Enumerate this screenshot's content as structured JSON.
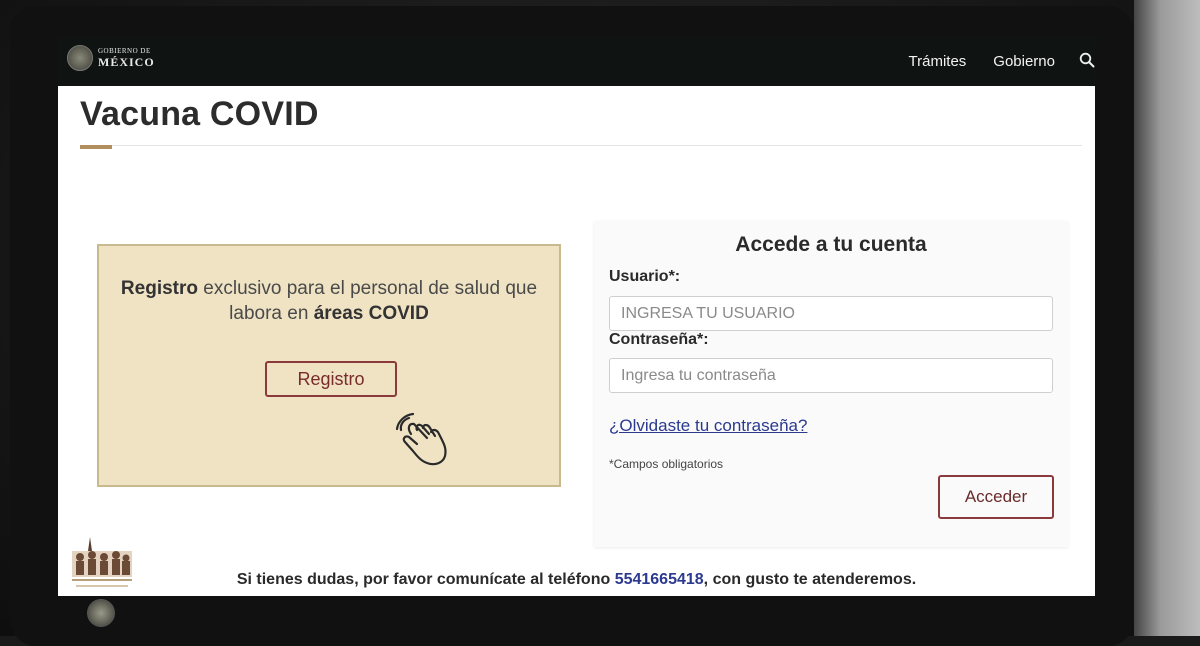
{
  "header": {
    "logo_line1": "GOBIERNO DE",
    "logo_line2": "MÉXICO",
    "nav": [
      {
        "label": "Trámites"
      },
      {
        "label": "Gobierno"
      }
    ]
  },
  "page": {
    "title": "Vacuna COVID"
  },
  "promo": {
    "text_bold1": "Registro",
    "text_mid": " exclusivo para el personal de salud que labora en ",
    "text_bold2": "áreas COVID",
    "button_label": "Registro"
  },
  "login": {
    "title": "Accede a tu cuenta",
    "user_label": "Usuario*:",
    "user_placeholder": "INGRESA TU USUARIO",
    "password_label": "Contraseña*:",
    "password_placeholder": "Ingresa tu contraseña",
    "forgot_link": "¿Olvidaste tu contraseña?",
    "required_note": "*Campos obligatorios",
    "submit_label": "Acceder"
  },
  "footer": {
    "text_before": "Si tienes dudas, por favor comunícate al teléfono ",
    "phone": "5541665418",
    "text_after": ", con gusto te atenderemos."
  },
  "colors": {
    "navbar_bg": "#0f1412",
    "accent_gold": "#b38e5d",
    "promo_bg": "#efe3c4",
    "button_border": "#8a3a3a",
    "link_blue": "#2b3a8f"
  }
}
